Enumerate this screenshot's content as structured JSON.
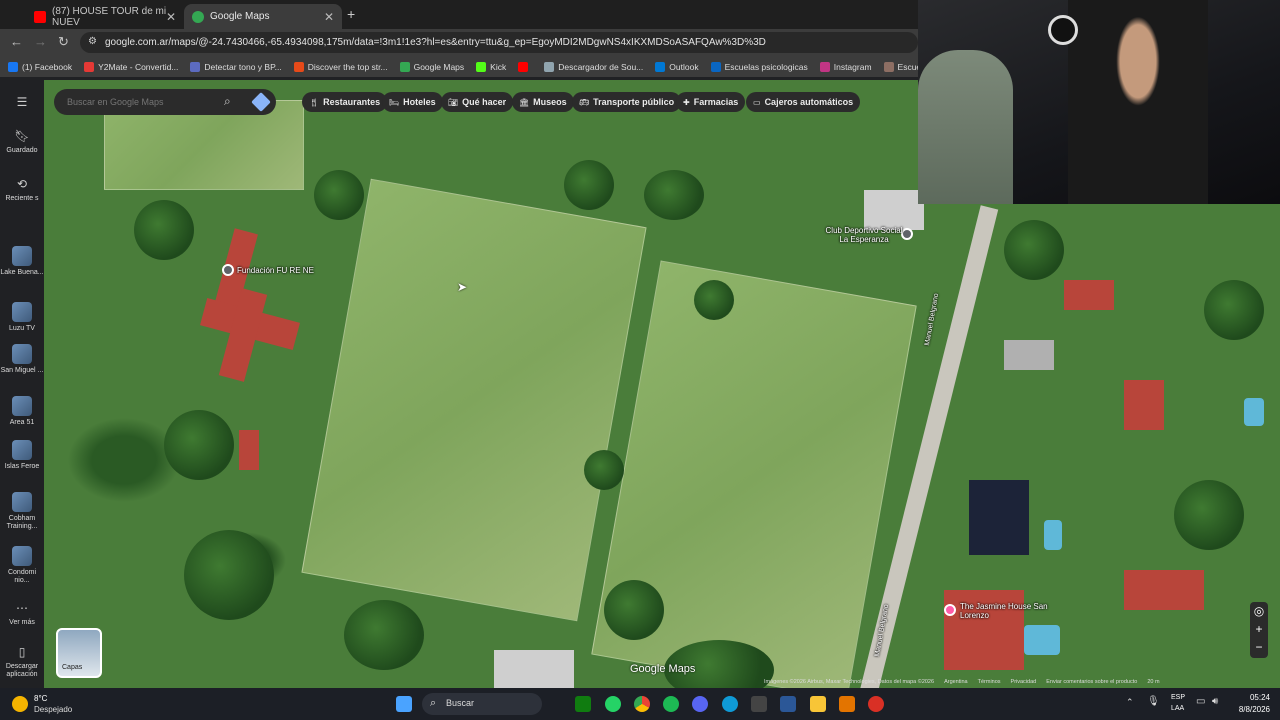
{
  "browser": {
    "tabs": [
      {
        "label": "(87) HOUSE TOUR de mi NUEV",
        "favicon_color": "#ff0000"
      },
      {
        "label": "Google Maps",
        "favicon_color": "#34a853"
      }
    ],
    "new_tab_label": "+",
    "url": "google.com.ar/maps/@-24.7430466,-65.4934098,175m/data=!3m1!1e3?hl=es&entry=ttu&g_ep=EgoyMDI2MDgwNS4xIKXMDSoASAFQAw%3D%3D",
    "bookmarks": [
      {
        "label": "(1) Facebook",
        "color": "#1877f2"
      },
      {
        "label": "Y2Mate - Convertid...",
        "color": "#e53935"
      },
      {
        "label": "Detectar tono y BP...",
        "color": "#5c6bc0"
      },
      {
        "label": "Discover the top str...",
        "color": "#e64a19"
      },
      {
        "label": "Google Maps",
        "color": "#34a853"
      },
      {
        "label": "Kick",
        "color": "#53fc18"
      },
      {
        "label": "",
        "color": "#ff0000"
      },
      {
        "label": "Descargador de Sou...",
        "color": "#90a4ae"
      },
      {
        "label": "Outlook",
        "color": "#0078d4"
      },
      {
        "label": "Escuelas psicologicas",
        "color": "#0a66c2"
      },
      {
        "label": "Instagram",
        "color": "#c13584"
      },
      {
        "label": "Escuelas de Psicol",
        "color": "#8d6e63"
      }
    ]
  },
  "maps": {
    "search_placeholder": "Buscar en Google Maps",
    "chips": [
      "Restaurantes",
      "Hoteles",
      "Qué hacer",
      "Museos",
      "Transporte público",
      "Farmacias",
      "Cajeros automáticos"
    ],
    "rail": [
      {
        "label": "Guardado"
      },
      {
        "label": "Reciente s"
      },
      {
        "label": "Lake Buena..."
      },
      {
        "label": "Luzu TV"
      },
      {
        "label": "San Miguel ..."
      },
      {
        "label": "Area 51"
      },
      {
        "label": "Islas Feroe"
      },
      {
        "label": "Cobham Training..."
      },
      {
        "label": "Condomi nio..."
      },
      {
        "label": "Ver más"
      },
      {
        "label": "Descargar aplicación"
      }
    ],
    "places": {
      "fundacion": "Fundación FU RE NE",
      "club": "Club Deportivo Social La Esperanza",
      "jasmine": "The Jasmine House San Lorenzo",
      "street1": "Manuel Belgrano",
      "street2": "Manuel Belgrano"
    },
    "layers_label": "Capas",
    "watermark": "Google Maps",
    "footer": [
      "Imágenes ©2026 Airbus, Maxar Technologies, Datos del mapa ©2026",
      "Argentina",
      "Términos",
      "Privacidad",
      "Enviar comentarios sobre el producto",
      "20 m"
    ]
  },
  "taskbar": {
    "weather_temp": "8°C",
    "weather_desc": "Despejado",
    "search_label": "Buscar",
    "lang": "ESP",
    "lang2": "LAA",
    "time": "05:24",
    "date": "8/8/2026"
  }
}
